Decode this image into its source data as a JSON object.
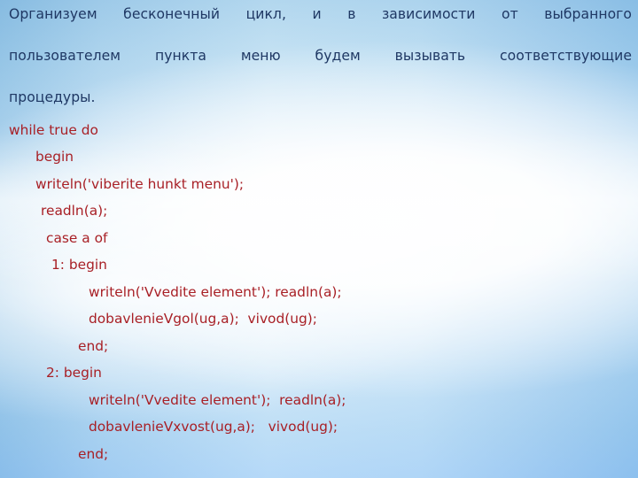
{
  "slide": {
    "background": {
      "edge_color": "#bcdcf0",
      "center_color": "#ffffff",
      "style": "light-blue-gradient"
    },
    "paragraph": {
      "color": "#1f3864",
      "line1": "Организуем бесконечный цикл, и в зависимости от выбранного",
      "line2": "пользователем пункта меню будем вызывать соответствующие",
      "line3": "процедуры."
    },
    "code": {
      "color": "#a81f25",
      "language": "Pascal",
      "lines": [
        {
          "indent": 0,
          "text": "while true do"
        },
        {
          "indent": 30,
          "text": "begin"
        },
        {
          "indent": 30,
          "text": "writeln('viberite hunkt menu');"
        },
        {
          "indent": 36,
          "text": "readln(a);"
        },
        {
          "indent": 42,
          "text": "case a of"
        },
        {
          "indent": 48,
          "text": "1: begin"
        },
        {
          "indent": 90,
          "text": "writeln('Vvedite element'); readln(a);"
        },
        {
          "indent": 90,
          "text": "dobavlenieVgol(ug,a);  vivod(ug);"
        },
        {
          "indent": 78,
          "text": "end;"
        },
        {
          "indent": 42,
          "text": "2: begin"
        },
        {
          "indent": 90,
          "text": "writeln('Vvedite element');  readln(a);"
        },
        {
          "indent": 90,
          "text": "dobavlenieVxvost(ug,a);   vivod(ug);"
        },
        {
          "indent": 78,
          "text": "end;"
        }
      ]
    }
  }
}
